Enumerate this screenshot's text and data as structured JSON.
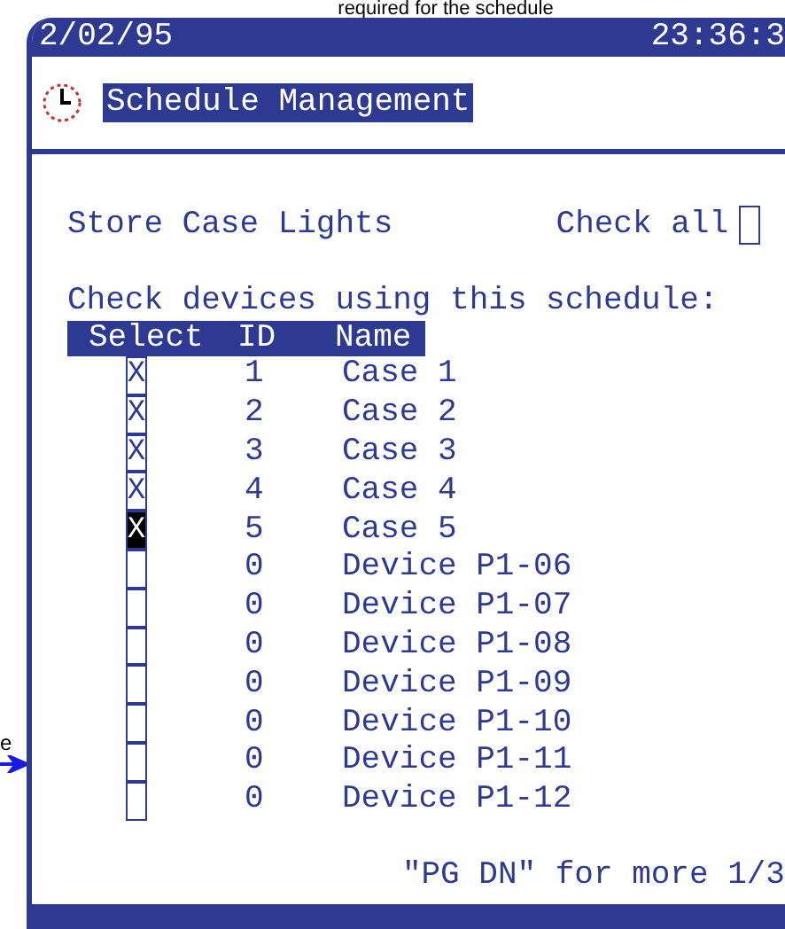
{
  "annotation_top": "required for the schedule",
  "annotation_left": "e",
  "top_bar": {
    "date": "2/02/95",
    "time": "23:36:3"
  },
  "title": "Schedule Management",
  "schedule_name": "Store Case Lights",
  "check_all": {
    "label": "Check all",
    "checked": false
  },
  "instruction": "Check devices using this schedule:",
  "columns": [
    "Select",
    "ID",
    "Name"
  ],
  "rows": [
    {
      "checked": true,
      "focused": false,
      "mark": "X",
      "id": "1",
      "name": "Case 1"
    },
    {
      "checked": true,
      "focused": false,
      "mark": "X",
      "id": "2",
      "name": "Case 2"
    },
    {
      "checked": true,
      "focused": false,
      "mark": "X",
      "id": "3",
      "name": "Case 3"
    },
    {
      "checked": true,
      "focused": false,
      "mark": "X",
      "id": "4",
      "name": "Case 4"
    },
    {
      "checked": true,
      "focused": true,
      "mark": "X",
      "id": "5",
      "name": "Case 5"
    },
    {
      "checked": false,
      "focused": false,
      "id": "0",
      "name": "Device P1-06"
    },
    {
      "checked": false,
      "focused": false,
      "id": "0",
      "name": "Device P1-07"
    },
    {
      "checked": false,
      "focused": false,
      "id": "0",
      "name": "Device P1-08"
    },
    {
      "checked": false,
      "focused": false,
      "id": "0",
      "name": "Device P1-09"
    },
    {
      "checked": false,
      "focused": false,
      "id": "0",
      "name": "Device P1-10"
    },
    {
      "checked": false,
      "focused": false,
      "id": "0",
      "name": "Device P1-11"
    },
    {
      "checked": false,
      "focused": false,
      "id": "0",
      "name": "Device P1-12"
    }
  ],
  "footer": "\"PG DN\" for more 1/3"
}
